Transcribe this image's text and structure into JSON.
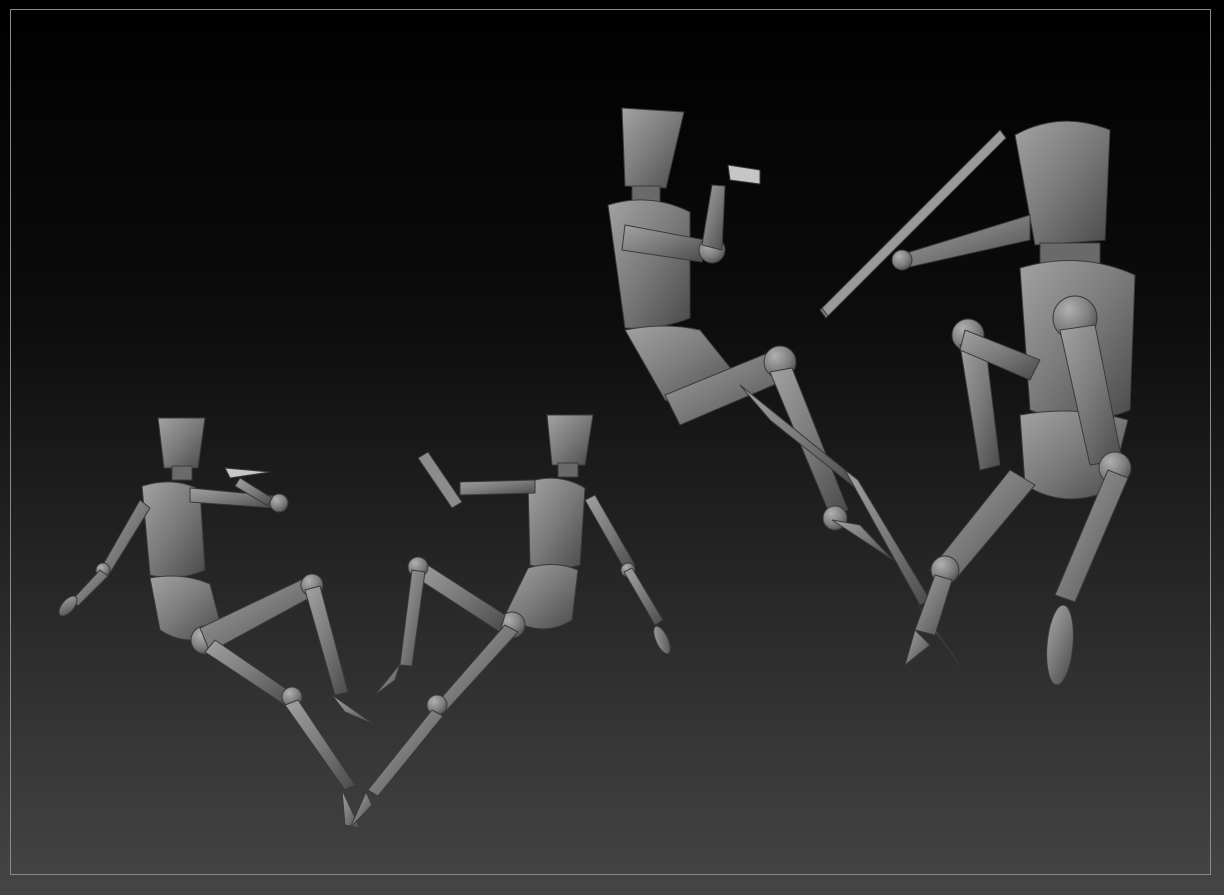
{
  "scene": {
    "background_top": "#000000",
    "background_bottom": "#454545",
    "frame_color": "#8a8a8a",
    "model_color": "#7b7b7b",
    "model_highlight": "#9c9c9c",
    "model_shadow": "#3f3f3f",
    "figures": [
      {
        "id": "figure-1",
        "prop": "knife"
      },
      {
        "id": "figure-2",
        "prop": "stick"
      },
      {
        "id": "figure-3",
        "prop": "knife"
      },
      {
        "id": "figure-4",
        "prop": "board"
      }
    ]
  }
}
